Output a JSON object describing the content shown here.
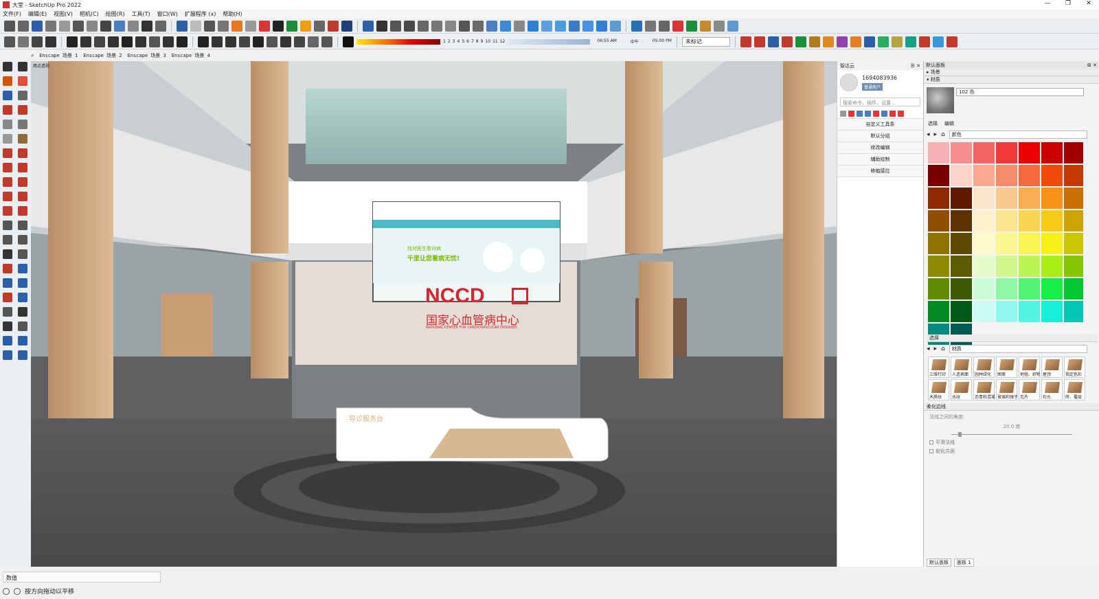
{
  "window": {
    "title": "大堂 - SketchUp Pro 2022",
    "controls": [
      "—",
      "❐",
      "✕"
    ]
  },
  "menu": [
    "文件(F)",
    "编辑(E)",
    "视图(V)",
    "相机(C)",
    "绘图(R)",
    "工具(T)",
    "窗口(W)",
    "扩展程序 (x)",
    "帮助(H)"
  ],
  "toolbar": {
    "shadow_scale": [
      "1",
      "2",
      "3",
      "4",
      "5",
      "6",
      "7",
      "8",
      "9",
      "10",
      "11",
      "12"
    ],
    "times": [
      "06:55 AM",
      "中午",
      "05:00 PM"
    ],
    "tag_dropdown": "未标记"
  },
  "scene_tabs": [
    "Enscape 场景 1",
    "Enscape 场景 2",
    "Enscape 场景 3",
    "Enscape 场景 4"
  ],
  "viewport": {
    "corner_label": "两点透视",
    "logo": "NCCD",
    "logo_cn": "国家心血管病中心",
    "logo_en": "NATIONAL CENTER FOR CARDIOVASCULAR DISEASES",
    "desk_label": "导诊服务台",
    "screen_line1": "找对医生看对病",
    "screen_line2": "千里让您看病无忧!"
  },
  "status": {
    "measure_label": "数值",
    "hint": "按方向拖动以平移"
  },
  "plugin_panel": {
    "title": "智达云",
    "user_id": "1694083936",
    "user_badge": "普通用户",
    "search_placeholder": "搜索命令、插件、设置...",
    "items": [
      "自定义工具条",
      "默认分组",
      "修改编辑",
      "辅助绘制",
      "移植接拉"
    ]
  },
  "tray": {
    "title": "默认面板",
    "sections": [
      "场景",
      "材质"
    ],
    "material_name": "102 色",
    "tabs": [
      "选择",
      "编辑"
    ],
    "library": "颜色",
    "select_label": "选择",
    "library2": "材质",
    "materials": [
      "三维打印",
      "人造表面",
      "园林绿化",
      "图案",
      "地毯、织物",
      "屋顶",
      "指定色彩",
      "木质纹",
      "水纹",
      "沥青和混凝土",
      "玻璃和镜子",
      "瓦片",
      "石头",
      "砖、覆层"
    ],
    "soften_title": "柔化边线",
    "angle_label": "法线之间的角度:",
    "angle_value": "20.0 度",
    "check_smooth": "平滑法线",
    "check_coplanar": "软化共面",
    "bottom_tabs": [
      "默认面板",
      "面板 1"
    ]
  },
  "colors": {
    "accent_logo": "#d7262f",
    "swatches": [
      "#f7b3b3",
      "#f78f8f",
      "#f56565",
      "#f23b3b",
      "#ee0000",
      "#cc0000",
      "#a50000",
      "#7a0000",
      "#fbd3c7",
      "#f8a98f",
      "#f68b6b",
      "#f46a3e",
      "#f04a0a",
      "#c23a00",
      "#8f2a00",
      "#5e1a00",
      "#fde5cc",
      "#fbc98f",
      "#f9ad52",
      "#f89216",
      "#cc6f00",
      "#8f4e00",
      "#5c3200",
      "#fdf1cc",
      "#fbe48f",
      "#f9d652",
      "#f8c916",
      "#cca400",
      "#8f7300",
      "#5c4a00",
      "#fdfbcc",
      "#fbf78f",
      "#f9f452",
      "#f8f016",
      "#ccc600",
      "#8f8b00",
      "#5c5a00",
      "#e6fbcc",
      "#d1f78f",
      "#bcf452",
      "#a6f016",
      "#86c600",
      "#5e8b00",
      "#3c5a00",
      "#ccfbd6",
      "#8ff7a6",
      "#52f476",
      "#16f046",
      "#00c630",
      "#008b22",
      "#005a16",
      "#ccfbf6",
      "#8ff7ed",
      "#52f4e4",
      "#16f0db",
      "#00c6b4",
      "#008b7e",
      "#005a52"
    ]
  }
}
